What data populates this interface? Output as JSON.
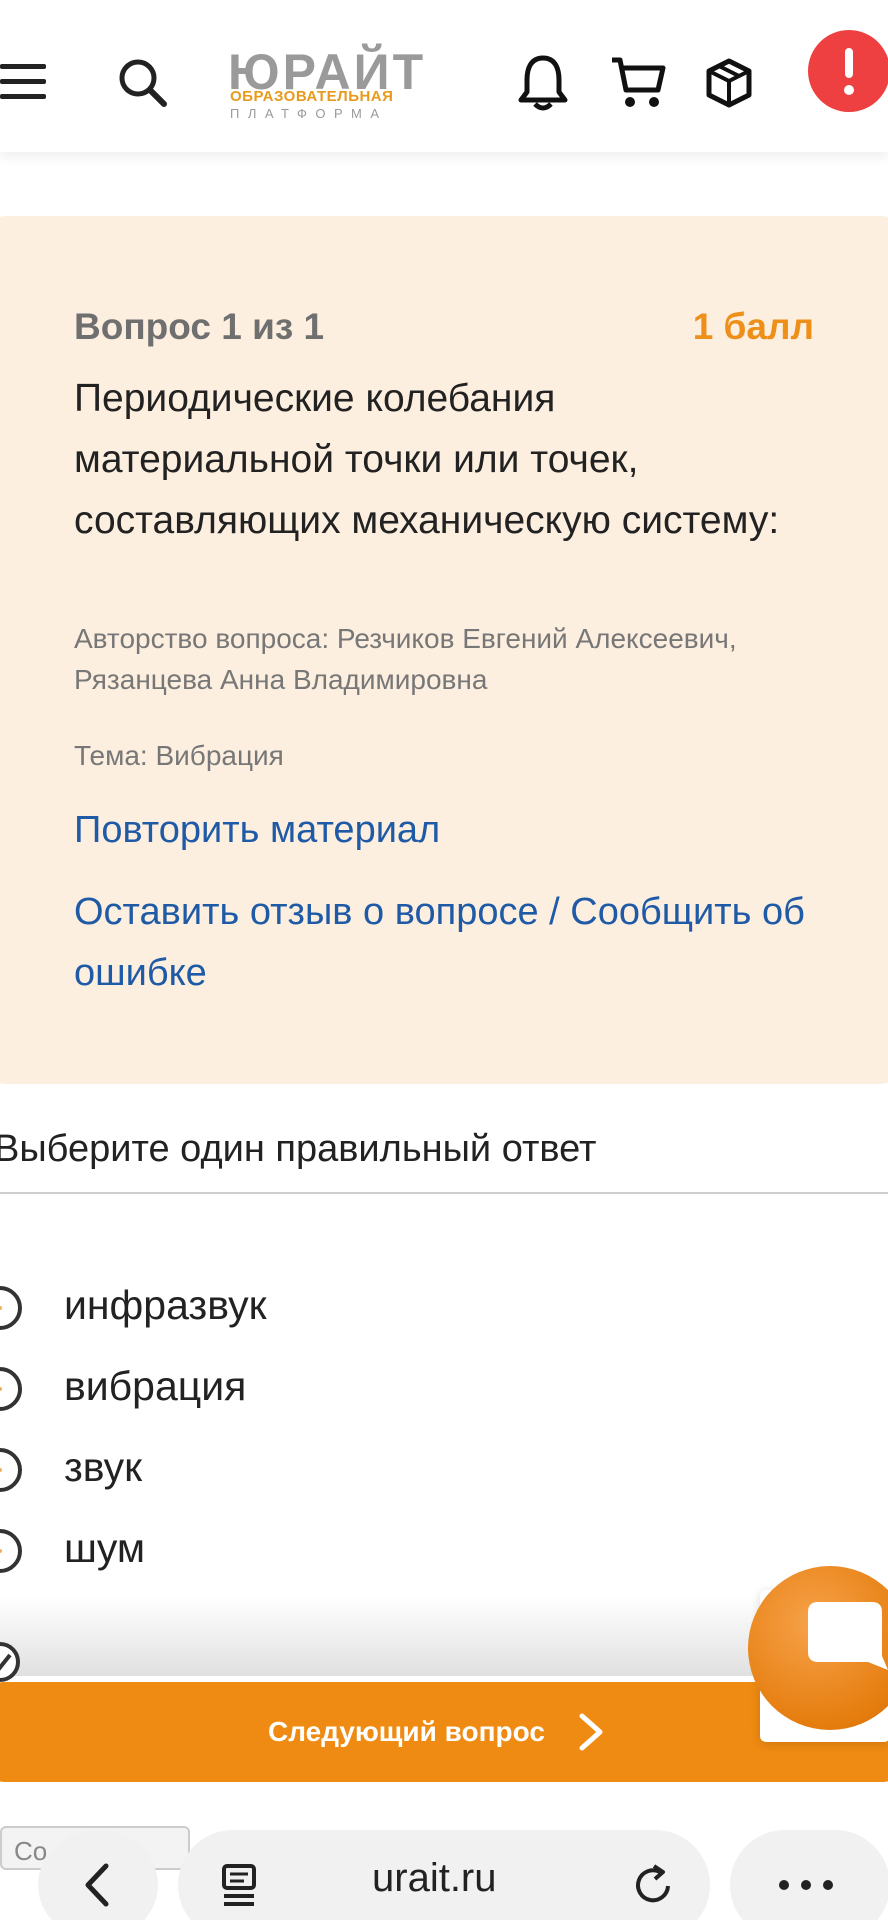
{
  "header": {
    "logo_main": "ЮРАЙТ",
    "logo_sub1": "ОБРАЗОВАТЕЛЬНАЯ",
    "logo_sub2": "ПЛАТФОРМА",
    "icons": [
      "menu-icon",
      "search-icon",
      "bell-icon",
      "cart-icon",
      "cube-icon",
      "alert-icon"
    ],
    "alert_color": "#ee4040"
  },
  "question": {
    "number": "Вопрос 1 из 1",
    "points": "1 балл",
    "text": "Периодические колебания материальной точки или точек, составляющих механическую систему:",
    "authors": "Авторство вопроса: Резчиков Евгений Алексеевич, Рязанцева Анна Владимировна",
    "topic": "Тема: Вибрация",
    "repeat_link": "Повторить материал",
    "feedback_link": "Оставить отзыв о вопросе / Сообщить об ошибке"
  },
  "answers": {
    "title": "Выберите один правильный ответ",
    "options": [
      {
        "label": "инфразвук",
        "selected": false
      },
      {
        "label": "вибрация",
        "selected": false
      },
      {
        "label": "звук",
        "selected": false
      },
      {
        "label": "шум",
        "selected": false
      }
    ]
  },
  "actions": {
    "next_label": "Следующий вопрос",
    "accent": "#ef8a12"
  },
  "browser": {
    "url": "urait.ru",
    "saved_label": "Со    о"
  }
}
